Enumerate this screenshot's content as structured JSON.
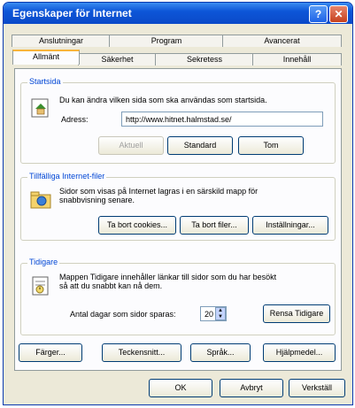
{
  "window": {
    "title": "Egenskaper för Internet",
    "help_symbol": "?",
    "close_symbol": "✕"
  },
  "tabs": {
    "back_row": [
      "Anslutningar",
      "Program",
      "Avancerat"
    ],
    "front_row": [
      "Allmänt",
      "Säkerhet",
      "Sekretess",
      "Innehåll"
    ],
    "active": "Allmänt"
  },
  "startsida": {
    "legend": "Startsida",
    "description": "Du kan ändra vilken sida som ska användas som startsida.",
    "address_label": "Adress:",
    "address_value": "http://www.hitnet.halmstad.se/",
    "buttons": [
      "Aktuell",
      "Standard",
      "Tom"
    ]
  },
  "temp_files": {
    "legend": "Tillfälliga Internet-filer",
    "description_line1": "Sidor som visas på Internet lagras i en särskild mapp för",
    "description_line2": "snabbvisning senare.",
    "buttons": [
      "Ta bort cookies...",
      "Ta bort filer...",
      "Inställningar..."
    ]
  },
  "history": {
    "legend": "Tidigare",
    "description_line1": "Mappen Tidigare innehåller länkar till sidor som du har besökt",
    "description_line2": "så att du snabbt kan nå dem.",
    "days_label": "Antal dagar som sidor sparas:",
    "days_value": "20",
    "clear_button": "Rensa Tidigare"
  },
  "bottom_buttons": [
    "Färger...",
    "Teckensnitt...",
    "Språk...",
    "Hjälpmedel..."
  ],
  "dialog_buttons": [
    "OK",
    "Avbryt",
    "Verkställ"
  ]
}
